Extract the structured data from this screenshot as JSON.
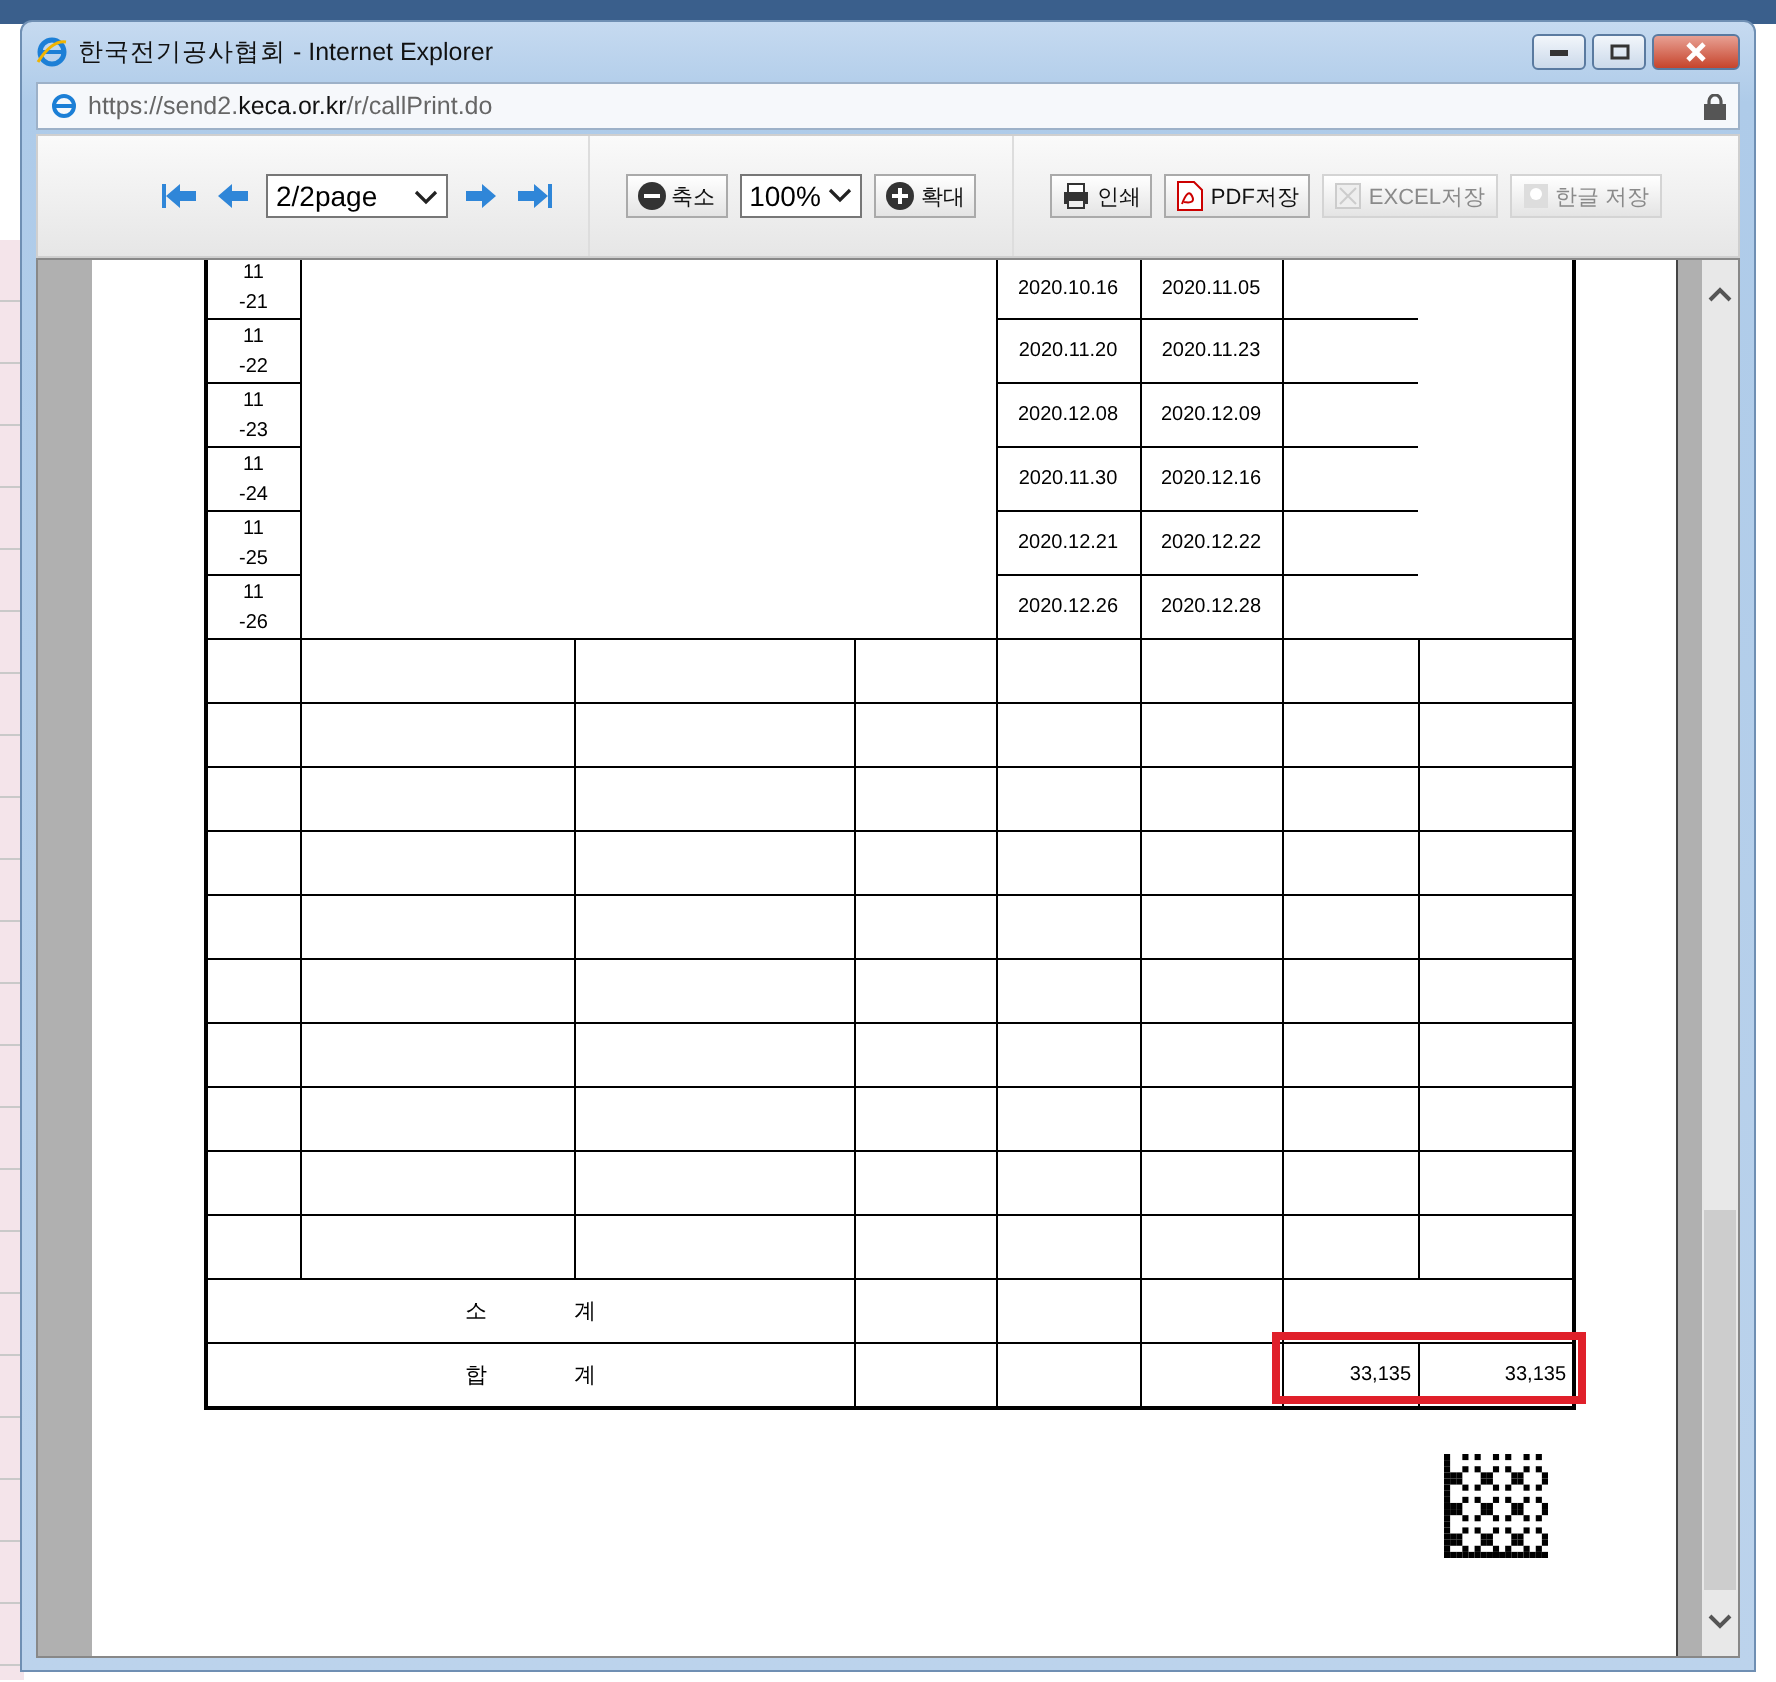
{
  "window": {
    "title": "한국전기공사협회 - Internet Explorer",
    "url_scheme": "https://send2.",
    "url_domain": "keca.or.kr",
    "url_path": "/r/callPrint.do"
  },
  "toolbar": {
    "page_select": "2/2page",
    "zoom_out": "축소",
    "zoom_select": "100%",
    "zoom_in": "확대",
    "actions": [
      {
        "kind": "print",
        "label": "인쇄",
        "disabled": false
      },
      {
        "kind": "pdf",
        "label": "PDF저장",
        "disabled": false
      },
      {
        "kind": "excel",
        "label": "EXCEL저장",
        "disabled": true
      },
      {
        "kind": "hwp",
        "label": "한글 저장",
        "disabled": true
      }
    ]
  },
  "report": {
    "item_rows": [
      {
        "number": [
          "11",
          "-21"
        ],
        "start_date": "2020.10.16",
        "end_date": "2020.11.05"
      },
      {
        "number": [
          "11",
          "-22"
        ],
        "start_date": "2020.11.20",
        "end_date": "2020.11.23"
      },
      {
        "number": [
          "11",
          "-23"
        ],
        "start_date": "2020.12.08",
        "end_date": "2020.12.09"
      },
      {
        "number": [
          "11",
          "-24"
        ],
        "start_date": "2020.11.30",
        "end_date": "2020.12.16"
      },
      {
        "number": [
          "11",
          "-25"
        ],
        "start_date": "2020.12.21",
        "end_date": "2020.12.22"
      },
      {
        "number": [
          "11",
          "-26"
        ],
        "start_date": "2020.12.26",
        "end_date": "2020.12.28"
      }
    ],
    "subtotal_label": "소 계",
    "total_label": "합 계",
    "total_values": [
      "33,135",
      "33,135"
    ],
    "total_highlighted": true
  }
}
